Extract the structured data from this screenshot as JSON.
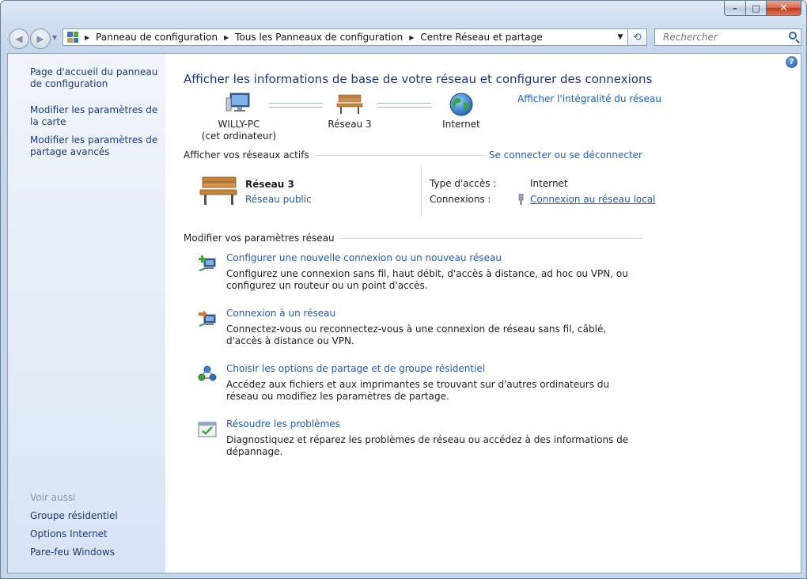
{
  "window": {
    "caption_buttons": {
      "minimize": "–",
      "maximize": "□",
      "close": "✕"
    }
  },
  "nav": {
    "back_icon": "back-arrow-icon",
    "forward_icon": "forward-arrow-icon",
    "breadcrumbs": [
      "Panneau de configuration",
      "Tous les Panneaux de configuration",
      "Centre Réseau et partage"
    ],
    "search_placeholder": "Rechercher"
  },
  "sidebar": {
    "links": [
      "Page d'accueil du panneau de configuration",
      "Modifier les paramètres de la carte",
      "Modifier les paramètres de partage avancés"
    ],
    "see_also_title": "Voir aussi",
    "see_also": [
      "Groupe résidentiel",
      "Options Internet",
      "Pare-feu Windows"
    ]
  },
  "main": {
    "title": "Afficher les informations de base de votre réseau et configurer des connexions",
    "map": {
      "computer_name": "WILLY-PC",
      "computer_sub": "(cet ordinateur)",
      "network_name": "Réseau  3",
      "internet_label": "Internet",
      "full_map_link": "Afficher l'intégralité du réseau"
    },
    "active_networks": {
      "header": "Afficher vos réseaux actifs",
      "connect_link": "Se connecter ou se déconnecter",
      "network_name": "Réseau  3",
      "network_type": "Réseau public",
      "access_type_label": "Type d'accès :",
      "access_type_value": "Internet",
      "connections_label": "Connexions :",
      "connections_value": "Connexion au réseau local"
    },
    "change_settings": {
      "header": "Modifier vos paramètres réseau",
      "items": [
        {
          "title": "Configurer une nouvelle connexion ou un nouveau réseau",
          "desc": "Configurez une connexion sans fil, haut débit, d'accès à distance, ad hoc ou VPN, ou configurez un routeur ou un point d'accès."
        },
        {
          "title": "Connexion à un réseau",
          "desc": "Connectez-vous ou reconnectez-vous à une connexion de réseau sans fil, câblé, d'accès à distance ou VPN."
        },
        {
          "title": "Choisir les options de partage et de groupe résidentiel",
          "desc": "Accédez aux fichiers et aux imprimantes se trouvant sur d'autres ordinateurs du réseau ou modifiez les paramètres de partage."
        },
        {
          "title": "Résoudre les problèmes",
          "desc": "Diagnostiquez et réparez les problèmes de réseau ou accédez à des informations de dépannage."
        }
      ]
    }
  }
}
